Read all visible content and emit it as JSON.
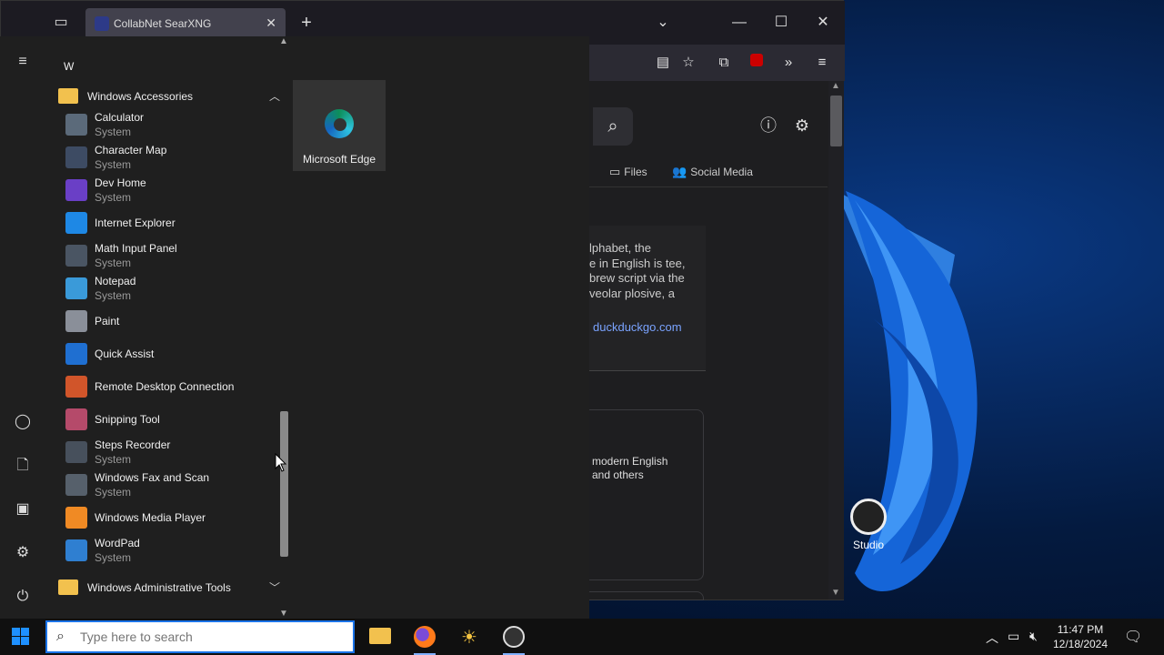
{
  "browser": {
    "tab_title": "CollabNet SearXNG",
    "categories": [
      {
        "icon": "files-icon",
        "label": "Files"
      },
      {
        "icon": "people-icon",
        "label": "Social Media"
      }
    ],
    "infobox_lines": [
      "lphabet, the",
      "e in English is tee,",
      "brew script via the",
      "veolar plosive, a"
    ],
    "infobox_link": "duckduckgo.com",
    "card_lines": [
      "modern English",
      "and others"
    ]
  },
  "start_menu": {
    "letter": "W",
    "accessories_folder": "Windows Accessories",
    "apps": [
      {
        "name": "Calculator",
        "sub": "System",
        "icon": "calculator-icon",
        "color": "#5b6a7a"
      },
      {
        "name": "Character Map",
        "sub": "System",
        "icon": "character-map-icon",
        "color": "#3d4b63"
      },
      {
        "name": "Dev Home",
        "sub": "System",
        "icon": "dev-home-icon",
        "color": "#6a3fc6"
      },
      {
        "name": "Internet Explorer",
        "sub": "",
        "icon": "internet-explorer-icon",
        "color": "#1e88e5"
      },
      {
        "name": "Math Input Panel",
        "sub": "System",
        "icon": "math-input-icon",
        "color": "#4a5563"
      },
      {
        "name": "Notepad",
        "sub": "System",
        "icon": "notepad-icon",
        "color": "#3a9ad9"
      },
      {
        "name": "Paint",
        "sub": "",
        "icon": "paint-icon",
        "color": "#8a8f99"
      },
      {
        "name": "Quick Assist",
        "sub": "",
        "icon": "quick-assist-icon",
        "color": "#1f6fd1"
      },
      {
        "name": "Remote Desktop Connection",
        "sub": "",
        "icon": "remote-desktop-icon",
        "color": "#d1552a"
      },
      {
        "name": "Snipping Tool",
        "sub": "",
        "icon": "snipping-tool-icon",
        "color": "#b54a6a"
      },
      {
        "name": "Steps Recorder",
        "sub": "System",
        "icon": "steps-recorder-icon",
        "color": "#47505c"
      },
      {
        "name": "Windows Fax and Scan",
        "sub": "System",
        "icon": "fax-scan-icon",
        "color": "#56606b"
      },
      {
        "name": "Windows Media Player",
        "sub": "",
        "icon": "media-player-icon",
        "color": "#f08a24"
      },
      {
        "name": "WordPad",
        "sub": "System",
        "icon": "wordpad-icon",
        "color": "#2f7fd1"
      }
    ],
    "admin_folder": "Windows Administrative Tools",
    "tile_label": "Microsoft Edge"
  },
  "desktop": {
    "icon_label": "Studio"
  },
  "taskbar": {
    "search_placeholder": "Type here to search",
    "time": "11:47 PM",
    "date": "12/18/2024"
  }
}
